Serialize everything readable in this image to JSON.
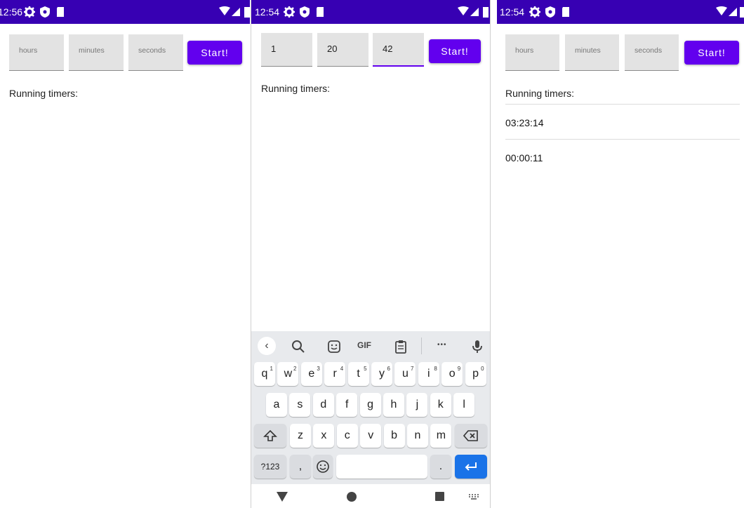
{
  "screens": {
    "left": {
      "status_time": "12:56",
      "fields": [
        "hours",
        "minutes",
        "seconds"
      ],
      "start_label": "Start!",
      "running_label": "Running timers:"
    },
    "middle": {
      "status_time": "12:54",
      "fields": [
        "1",
        "20",
        "42"
      ],
      "start_label": "Start!",
      "running_label": "Running timers:",
      "keyboard": {
        "row1": [
          {
            "k": "q",
            "s": "1"
          },
          {
            "k": "w",
            "s": "2"
          },
          {
            "k": "e",
            "s": "3"
          },
          {
            "k": "r",
            "s": "4"
          },
          {
            "k": "t",
            "s": "5"
          },
          {
            "k": "y",
            "s": "6"
          },
          {
            "k": "u",
            "s": "7"
          },
          {
            "k": "i",
            "s": "8"
          },
          {
            "k": "o",
            "s": "9"
          },
          {
            "k": "p",
            "s": "0"
          }
        ],
        "row2": [
          "a",
          "s",
          "d",
          "f",
          "g",
          "h",
          "j",
          "k",
          "l"
        ],
        "row3": [
          "z",
          "x",
          "c",
          "v",
          "b",
          "n",
          "m"
        ],
        "symbols_label": "?123",
        "comma": ",",
        "period": ".",
        "gif_label": "GIF",
        "more_label": "•••"
      }
    },
    "right": {
      "status_time": "12:54",
      "fields": [
        "hours",
        "minutes",
        "seconds"
      ],
      "start_label": "Start!",
      "running_label": "Running timers:",
      "timers": [
        "03:23:14",
        "00:00:11"
      ]
    }
  },
  "colors": {
    "status_bar": "#3700b3",
    "accent": "#6200ee",
    "enter_key": "#1a73e8"
  }
}
